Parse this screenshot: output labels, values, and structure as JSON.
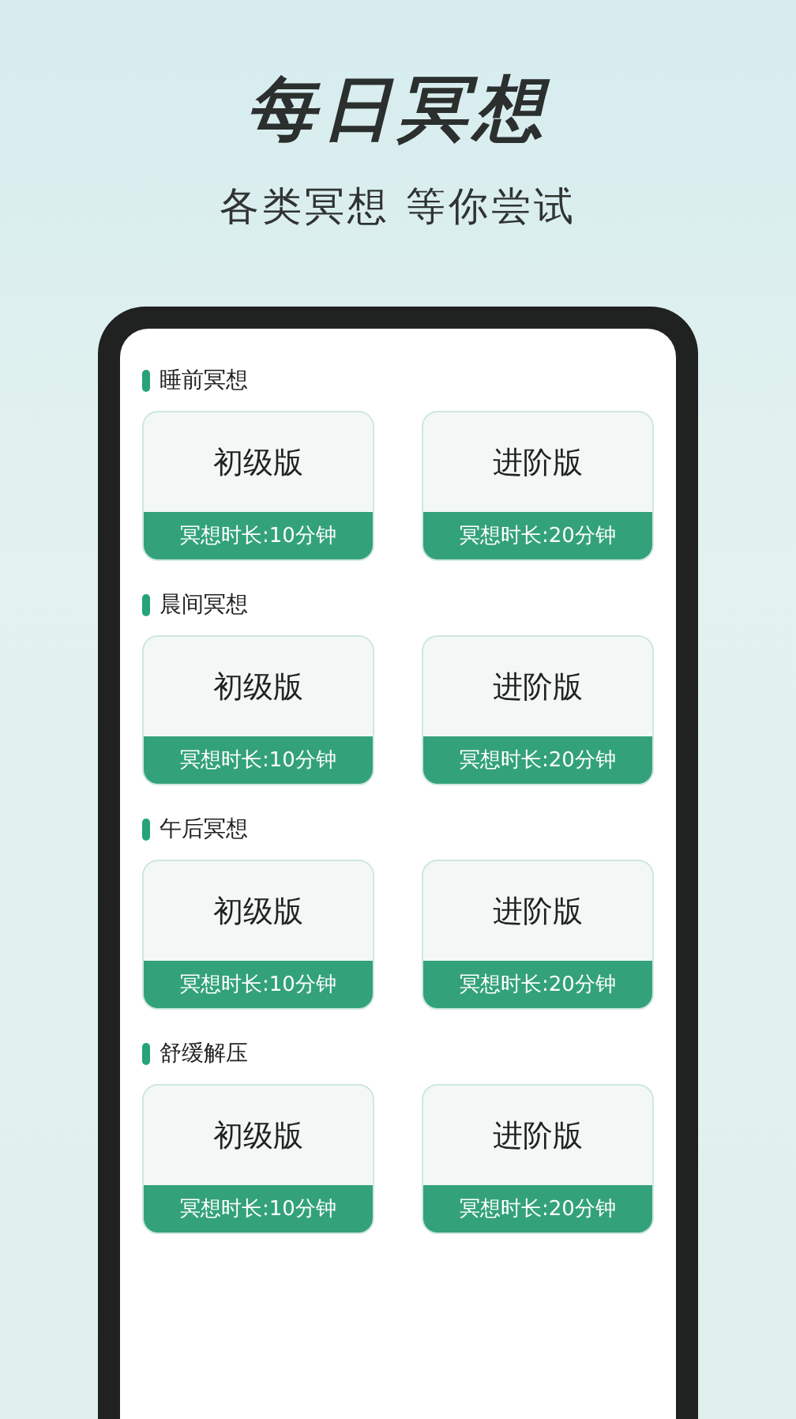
{
  "headline": "每日冥想",
  "subtitle": "各类冥想 等你尝试",
  "sections": [
    {
      "title": "睡前冥想",
      "cards": [
        {
          "title": "初级版",
          "duration": "冥想时长:10分钟"
        },
        {
          "title": "进阶版",
          "duration": "冥想时长:20分钟"
        }
      ]
    },
    {
      "title": "晨间冥想",
      "cards": [
        {
          "title": "初级版",
          "duration": "冥想时长:10分钟"
        },
        {
          "title": "进阶版",
          "duration": "冥想时长:20分钟"
        }
      ]
    },
    {
      "title": "午后冥想",
      "cards": [
        {
          "title": "初级版",
          "duration": "冥想时长:10分钟"
        },
        {
          "title": "进阶版",
          "duration": "冥想时长:20分钟"
        }
      ]
    },
    {
      "title": "舒缓解压",
      "cards": [
        {
          "title": "初级版",
          "duration": "冥想时长:10分钟"
        },
        {
          "title": "进阶版",
          "duration": "冥想时长:20分钟"
        }
      ]
    }
  ]
}
